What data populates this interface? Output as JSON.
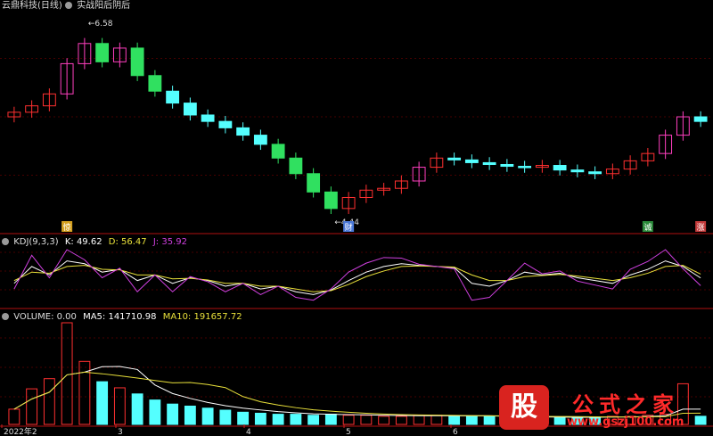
{
  "main_panel": {
    "title": "云鼎科技(日线)",
    "indicator_name": "实战阳后阴后",
    "high_label": "6.58",
    "low_label": "4.44"
  },
  "signals": [
    {
      "label": "惊",
      "color": "#d4a020",
      "x_index": 3
    },
    {
      "label": "财",
      "color": "#4a78d8",
      "x_index": 19
    },
    {
      "label": "诚",
      "color": "#2a8a3a",
      "x_index": 36
    },
    {
      "label": "涨",
      "color": "#c23a3a",
      "x_index": 39
    }
  ],
  "kdj_panel": {
    "title": "KDJ(9,3,3)",
    "k_label": "K: 49.62",
    "d_label": "D: 56.47",
    "j_label": "J: 35.92",
    "k_color": "#ffffff",
    "d_color": "#e8e03a",
    "j_color": "#d040e0"
  },
  "volume_panel": {
    "title": "VOLUME: 0.00",
    "ma5_label": "MA5: 141710.98",
    "ma10_label": "MA10: 191657.72",
    "ma5_color": "#ffffff",
    "ma10_color": "#e8e03a"
  },
  "x_axis_labels": [
    "2022年2",
    "3",
    "4",
    "5",
    "6"
  ],
  "watermark": {
    "logo": "股",
    "title": "公式之家",
    "url": "www.gszj100.com"
  },
  "colors": {
    "up": "#ff3030",
    "down": "#54ffff",
    "up_large": "#ff3fbf",
    "down_large": "#30e060",
    "grid": "#8b0000"
  },
  "chart_data": {
    "type": "candlestick",
    "price_min": 4.44,
    "price_max": 6.58,
    "close": [
      5.55,
      5.62,
      5.75,
      6.08,
      6.3,
      6.1,
      6.25,
      5.95,
      5.78,
      5.65,
      5.52,
      5.45,
      5.38,
      5.3,
      5.2,
      5.05,
      4.88,
      4.68,
      4.5,
      4.62,
      4.7,
      4.72,
      4.8,
      4.95,
      5.05,
      5.03,
      5.0,
      4.98,
      4.96,
      4.95,
      4.97,
      4.92,
      4.9,
      4.88,
      4.93,
      5.02,
      5.1,
      5.3,
      5.5,
      5.45
    ],
    "volume_scale": [
      0.15,
      0.35,
      0.45,
      1.0,
      0.62,
      0.42,
      0.36,
      0.3,
      0.24,
      0.2,
      0.18,
      0.16,
      0.14,
      0.12,
      0.11,
      0.1,
      0.1,
      0.09,
      0.1,
      0.09,
      0.09,
      0.08,
      0.08,
      0.09,
      0.09,
      0.08,
      0.08,
      0.08,
      0.07,
      0.07,
      0.07,
      0.07,
      0.07,
      0.07,
      0.08,
      0.08,
      0.09,
      0.1,
      0.4,
      0.08
    ],
    "k": [
      40,
      70,
      55,
      80,
      75,
      60,
      65,
      45,
      55,
      40,
      50,
      45,
      35,
      40,
      30,
      35,
      25,
      20,
      28,
      45,
      60,
      70,
      75,
      72,
      70,
      68,
      40,
      35,
      45,
      60,
      55,
      58,
      50,
      45,
      40,
      55,
      65,
      80,
      70,
      49.62
    ],
    "d": [
      45,
      60,
      58,
      70,
      72,
      65,
      64,
      55,
      55,
      48,
      49,
      46,
      40,
      40,
      35,
      35,
      30,
      25,
      27,
      38,
      52,
      62,
      70,
      71,
      70,
      69,
      55,
      45,
      45,
      52,
      54,
      56,
      53,
      49,
      45,
      50,
      58,
      70,
      72,
      56.47
    ],
    "j": [
      30,
      90,
      50,
      100,
      82,
      50,
      67,
      25,
      55,
      25,
      52,
      43,
      25,
      40,
      20,
      35,
      15,
      10,
      30,
      60,
      76,
      86,
      85,
      74,
      70,
      66,
      10,
      15,
      45,
      76,
      57,
      62,
      44,
      37,
      30,
      65,
      79,
      100,
      66,
      35.92
    ]
  }
}
